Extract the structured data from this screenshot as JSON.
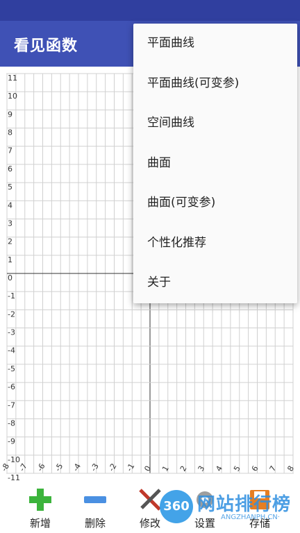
{
  "app": {
    "title": "看见函数"
  },
  "graph": {
    "y_ticks": [
      "11",
      "10",
      "9",
      "8",
      "7",
      "6",
      "5",
      "4",
      "3",
      "2",
      "1",
      "0",
      "-1",
      "-2",
      "-3",
      "-4",
      "-5",
      "-6",
      "-7",
      "-8",
      "-9",
      "-10",
      "-11"
    ],
    "x_ticks": [
      "-8",
      "-7",
      "-6",
      "-5",
      "-4",
      "-3",
      "-2",
      "-1",
      "0",
      "1",
      "2",
      "3",
      "4",
      "5",
      "6",
      "7",
      "8"
    ]
  },
  "menu": {
    "items": [
      "平面曲线",
      "平面曲线(可变参)",
      "空间曲线",
      "曲面",
      "曲面(可变参)",
      "个性化推荐",
      "关于"
    ]
  },
  "toolbar": {
    "add_label": "新增",
    "delete_label": "删除",
    "edit_label": "修改",
    "settings_label": "设置",
    "save_label": "存储"
  },
  "watermark": {
    "circle": "360",
    "text": "网站排行榜",
    "sub": "ANGZHANPH.CN·"
  },
  "colors": {
    "statusbar": "#303f9f",
    "appbar": "#3f51b5",
    "add_icon": "#3cb43c",
    "delete_icon": "#4a90e2"
  }
}
